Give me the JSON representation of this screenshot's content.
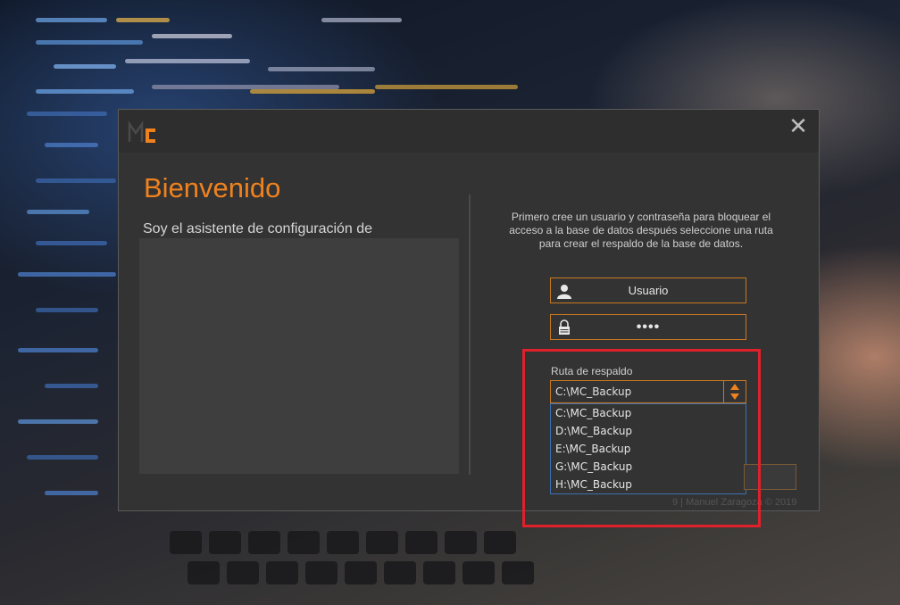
{
  "window": {
    "close_symbol": "✕"
  },
  "welcome": {
    "title": "Bienvenido",
    "intro": "Soy el asistente de configuración de"
  },
  "setup": {
    "instructions": "Primero cree un usuario y contraseña para bloquear el acceso a la base de datos después seleccione una ruta para crear el respaldo de la base de datos.",
    "username_value": "Usuario",
    "password_value": "••••",
    "backup_label": "Ruta de respaldo",
    "backup_selected": "C:\\MC_Backup",
    "backup_options": [
      "C:\\MC_Backup",
      "D:\\MC_Backup",
      "E:\\MC_Backup",
      "G:\\MC_Backup",
      "H:\\MC_Backup"
    ],
    "footer": "9 | Manuel Zaragoza © 2019"
  },
  "icons": {
    "logo": "mc-logo-icon",
    "user": "user-icon",
    "lock": "lock-icon",
    "close": "close-icon",
    "select_arrows": "up-down-arrows-icon"
  },
  "colors": {
    "accent": "#f0821e",
    "dialog_bg": "#333333",
    "highlight": "#e0202a",
    "dropdown_border": "#3d6fb4"
  }
}
